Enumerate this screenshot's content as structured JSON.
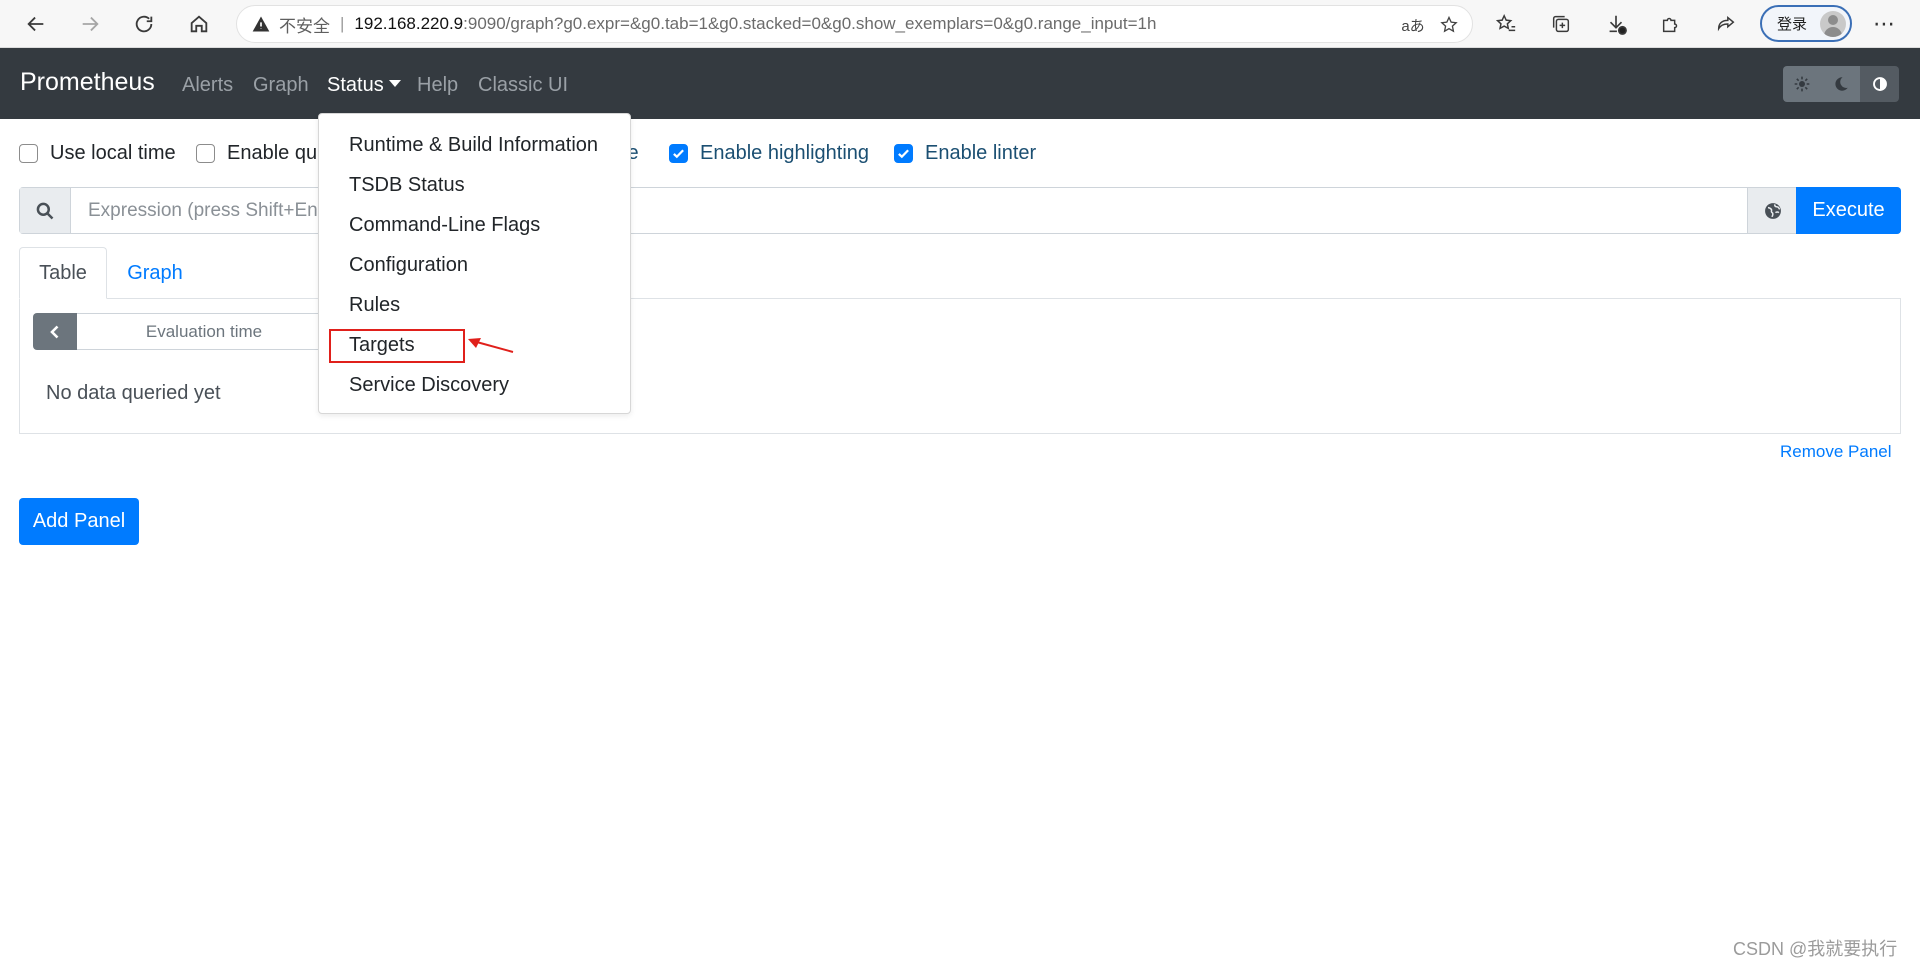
{
  "browser": {
    "security_label": "不安全",
    "url_host": "192.168.220.9",
    "url_rest": ":9090/graph?g0.expr=&g0.tab=1&g0.stacked=0&g0.show_exemplars=0&g0.range_input=1h",
    "login_label": "登录",
    "read_aloud_glyph": "aあ"
  },
  "navbar": {
    "brand": "Prometheus",
    "links": [
      "Alerts",
      "Graph",
      "Status",
      "Help",
      "Classic UI"
    ],
    "active_link": "Status"
  },
  "status_menu": {
    "items": [
      "Runtime & Build Information",
      "TSDB Status",
      "Command-Line Flags",
      "Configuration",
      "Rules",
      "Targets",
      "Service Discovery"
    ],
    "highlighted_item": "Targets",
    "highlight_color": "#e0201b"
  },
  "options": {
    "use_local_time": {
      "label": "Use local time",
      "checked": false
    },
    "enable_query_history": {
      "label": "Enable que",
      "checked": false
    },
    "enable_autocomplete_fragment": {
      "label": "te"
    },
    "enable_highlighting": {
      "label": "Enable highlighting",
      "checked": true
    },
    "enable_linter": {
      "label": "Enable linter",
      "checked": true
    }
  },
  "expression": {
    "placeholder": "Expression (press Shift+Enter for newlines)",
    "execute_label": "Execute"
  },
  "tabs": {
    "table": "Table",
    "graph": "Graph",
    "active": "Table"
  },
  "table_panel": {
    "evaluation_time_placeholder": "Evaluation time",
    "empty_message": "No data queried yet"
  },
  "actions": {
    "remove_panel": "Remove Panel",
    "add_panel": "Add Panel"
  },
  "colors": {
    "navbar_bg": "#343a40",
    "primary": "#007bff"
  },
  "watermark": "CSDN @我就要执行"
}
